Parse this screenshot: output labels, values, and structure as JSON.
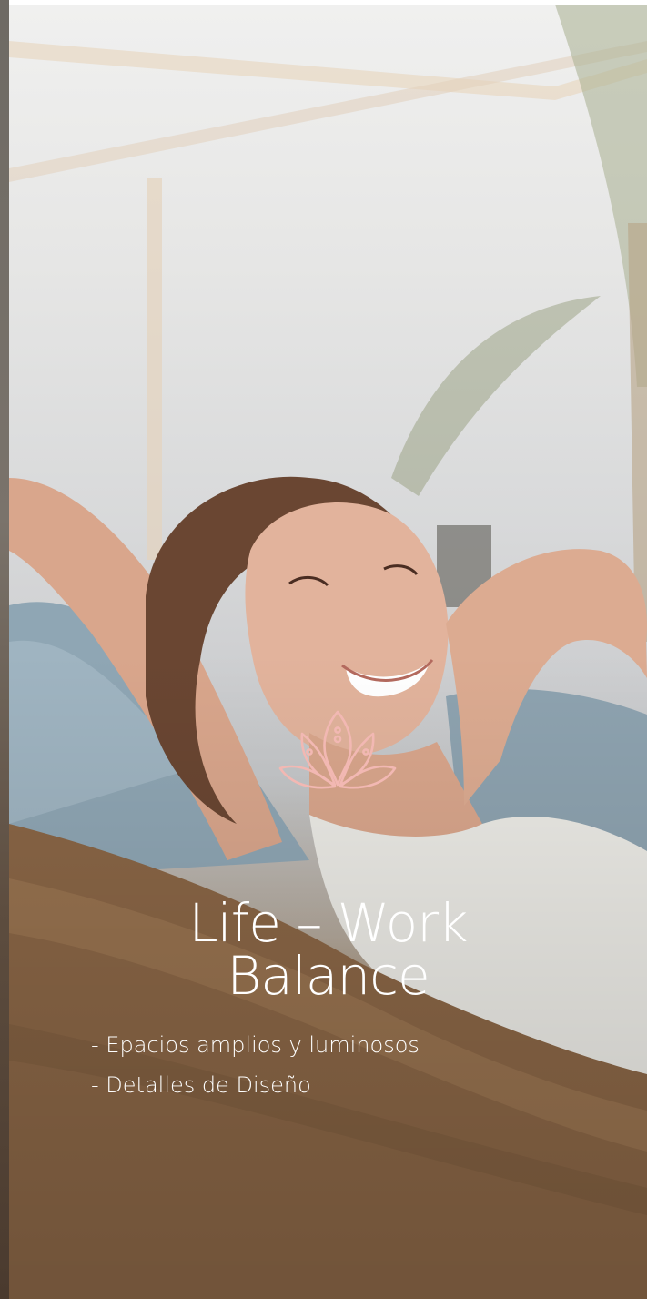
{
  "hero": {
    "title_line1": "Life – Work",
    "title_line2": "Balance",
    "icon": "lotus-icon",
    "icon_color": "#f2b8b3"
  },
  "features": {
    "items": [
      "- Epacios amplios y luminosos",
      "- Detalles de Diseño"
    ]
  },
  "colors": {
    "text": "#ffffff",
    "accent": "#f2b8b3"
  }
}
